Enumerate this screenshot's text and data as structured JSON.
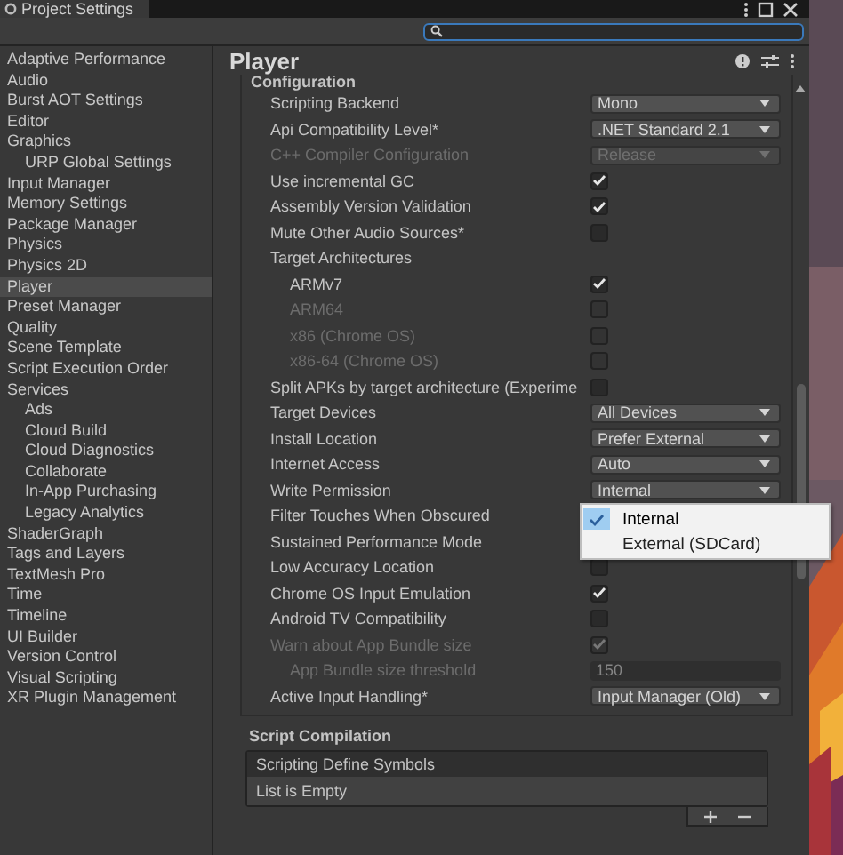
{
  "window": {
    "title": "Project Settings"
  },
  "sidebar": {
    "items": [
      {
        "label": "Adaptive Performance",
        "selected": false
      },
      {
        "label": "Audio",
        "selected": false
      },
      {
        "label": "Burst AOT Settings",
        "selected": false
      },
      {
        "label": "Editor",
        "selected": false
      },
      {
        "label": "Graphics",
        "selected": false,
        "children": [
          {
            "label": "URP Global Settings",
            "selected": false
          }
        ]
      },
      {
        "label": "Input Manager",
        "selected": false
      },
      {
        "label": "Memory Settings",
        "selected": false
      },
      {
        "label": "Package Manager",
        "selected": false
      },
      {
        "label": "Physics",
        "selected": false
      },
      {
        "label": "Physics 2D",
        "selected": false
      },
      {
        "label": "Player",
        "selected": true
      },
      {
        "label": "Preset Manager",
        "selected": false
      },
      {
        "label": "Quality",
        "selected": false
      },
      {
        "label": "Scene Template",
        "selected": false
      },
      {
        "label": "Script Execution Order",
        "selected": false
      },
      {
        "label": "Services",
        "selected": false,
        "children": [
          {
            "label": "Ads",
            "selected": false
          },
          {
            "label": "Cloud Build",
            "selected": false
          },
          {
            "label": "Cloud Diagnostics",
            "selected": false
          },
          {
            "label": "Collaborate",
            "selected": false
          },
          {
            "label": "In-App Purchasing",
            "selected": false
          },
          {
            "label": "Legacy Analytics",
            "selected": false
          }
        ]
      },
      {
        "label": "ShaderGraph",
        "selected": false
      },
      {
        "label": "Tags and Layers",
        "selected": false
      },
      {
        "label": "TextMesh Pro",
        "selected": false
      },
      {
        "label": "Time",
        "selected": false
      },
      {
        "label": "Timeline",
        "selected": false
      },
      {
        "label": "UI Builder",
        "selected": false
      },
      {
        "label": "Version Control",
        "selected": false
      },
      {
        "label": "Visual Scripting",
        "selected": false
      },
      {
        "label": "XR Plugin Management",
        "selected": false
      }
    ]
  },
  "panel": {
    "title": "Player",
    "section": "Configuration",
    "rows": [
      {
        "label": "Scripting Backend",
        "kind": "dropdown",
        "value": "Mono",
        "disabled": false
      },
      {
        "label": "Api Compatibility Level*",
        "kind": "dropdown",
        "value": ".NET Standard 2.1",
        "disabled": false
      },
      {
        "label": "C++ Compiler Configuration",
        "kind": "dropdown",
        "value": "Release",
        "disabled": true
      },
      {
        "label": "Use incremental GC",
        "kind": "checkbox",
        "checked": true,
        "disabled": false
      },
      {
        "label": "Assembly Version Validation",
        "kind": "checkbox",
        "checked": true,
        "disabled": false
      },
      {
        "label": "Mute Other Audio Sources*",
        "kind": "checkbox",
        "checked": false,
        "disabled": false
      },
      {
        "label": "Target Architectures",
        "kind": "label",
        "disabled": false,
        "children": [
          {
            "label": "ARMv7",
            "kind": "checkbox",
            "checked": true,
            "disabled": false
          },
          {
            "label": "ARM64",
            "kind": "checkbox",
            "checked": false,
            "disabled": true
          },
          {
            "label": "x86 (Chrome OS)",
            "kind": "checkbox",
            "checked": false,
            "disabled": true
          },
          {
            "label": "x86-64 (Chrome OS)",
            "kind": "checkbox",
            "checked": false,
            "disabled": true
          }
        ]
      },
      {
        "label": "Split APKs by target architecture (Experime",
        "kind": "checkbox",
        "checked": false,
        "disabled": false
      },
      {
        "label": "Target Devices",
        "kind": "dropdown",
        "value": "All Devices",
        "disabled": false
      },
      {
        "label": "Install Location",
        "kind": "dropdown",
        "value": "Prefer External",
        "disabled": false
      },
      {
        "label": "Internet Access",
        "kind": "dropdown",
        "value": "Auto",
        "disabled": false
      },
      {
        "label": "Write Permission",
        "kind": "dropdown",
        "value": "Internal",
        "disabled": false
      },
      {
        "label": "Filter Touches When Obscured",
        "kind": "label",
        "disabled": false
      },
      {
        "label": "Sustained Performance Mode",
        "kind": "label",
        "disabled": false
      },
      {
        "label": "Low Accuracy Location",
        "kind": "checkbox",
        "checked": false,
        "disabled": false
      },
      {
        "label": "Chrome OS Input Emulation",
        "kind": "checkbox",
        "checked": true,
        "disabled": false
      },
      {
        "label": "Android TV Compatibility",
        "kind": "checkbox",
        "checked": false,
        "disabled": false
      },
      {
        "label": "Warn about App Bundle size",
        "kind": "checkbox",
        "checked": true,
        "disabled": true,
        "children": [
          {
            "label": "App Bundle size threshold",
            "kind": "number",
            "value": "150",
            "disabled": true
          }
        ]
      },
      {
        "label": "Active Input Handling*",
        "kind": "dropdown",
        "value": "Input Manager (Old)",
        "disabled": false
      }
    ],
    "script_compilation": {
      "title": "Script Compilation",
      "list_header": "Scripting Define Symbols",
      "empty_text": "List is Empty"
    }
  },
  "popup": {
    "items": [
      {
        "label": "Internal",
        "selected": true
      },
      {
        "label": "External (SDCard)",
        "selected": false
      }
    ]
  }
}
